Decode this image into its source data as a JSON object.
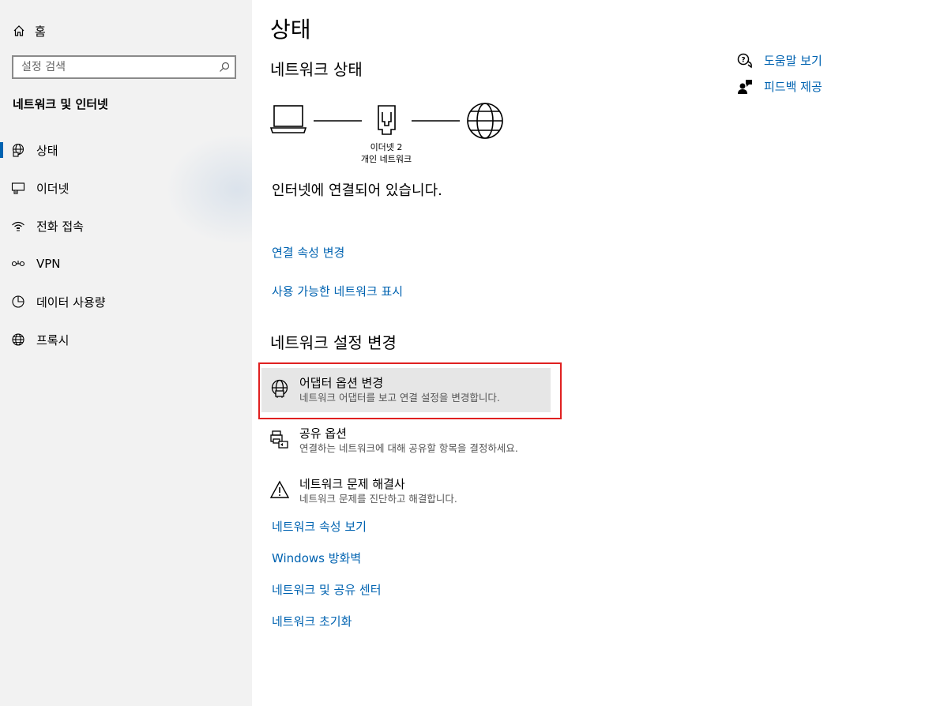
{
  "sidebar": {
    "home_label": "홈",
    "search_placeholder": "설정 검색",
    "section_title": "네트워크 및 인터넷",
    "items": [
      {
        "label": "상태",
        "icon": "globe-status-icon",
        "active": true
      },
      {
        "label": "이더넷",
        "icon": "ethernet-icon"
      },
      {
        "label": "전화 접속",
        "icon": "dial-up-icon"
      },
      {
        "label": "VPN",
        "icon": "vpn-icon"
      },
      {
        "label": "데이터 사용량",
        "icon": "data-usage-icon"
      },
      {
        "label": "프록시",
        "icon": "proxy-globe-icon"
      }
    ]
  },
  "main": {
    "title": "상태",
    "network_status_heading": "네트워크 상태",
    "adapter_name": "이더넷 2",
    "network_type": "개인 네트워크",
    "connected_text": "인터넷에 연결되어 있습니다.",
    "links_top": [
      "연결 속성 변경",
      "사용 가능한 네트워크 표시"
    ],
    "change_settings_heading": "네트워크 설정 변경",
    "options": [
      {
        "title": "어댑터 옵션 변경",
        "desc": "네트워크 어댑터를 보고 연결 설정을 변경합니다.",
        "icon": "adapter-globe-icon",
        "highlighted": true
      },
      {
        "title": "공유 옵션",
        "desc": "연결하는 네트워크에 대해 공유할 항목을 결정하세요.",
        "icon": "sharing-printer-icon"
      },
      {
        "title": "네트워크 문제 해결사",
        "desc": "네트워크 문제를 진단하고 해결합니다.",
        "icon": "warning-triangle-icon"
      }
    ],
    "links_bottom": [
      "네트워크 속성 보기",
      "Windows 방화벽",
      "네트워크 및 공유 센터",
      "네트워크 초기화"
    ]
  },
  "right": {
    "help_label": "도움말 보기",
    "feedback_label": "피드백 제공"
  },
  "colors": {
    "accent": "#0063b1",
    "sidebar_bg": "#f2f2f2",
    "highlight_box": "#e02020"
  }
}
